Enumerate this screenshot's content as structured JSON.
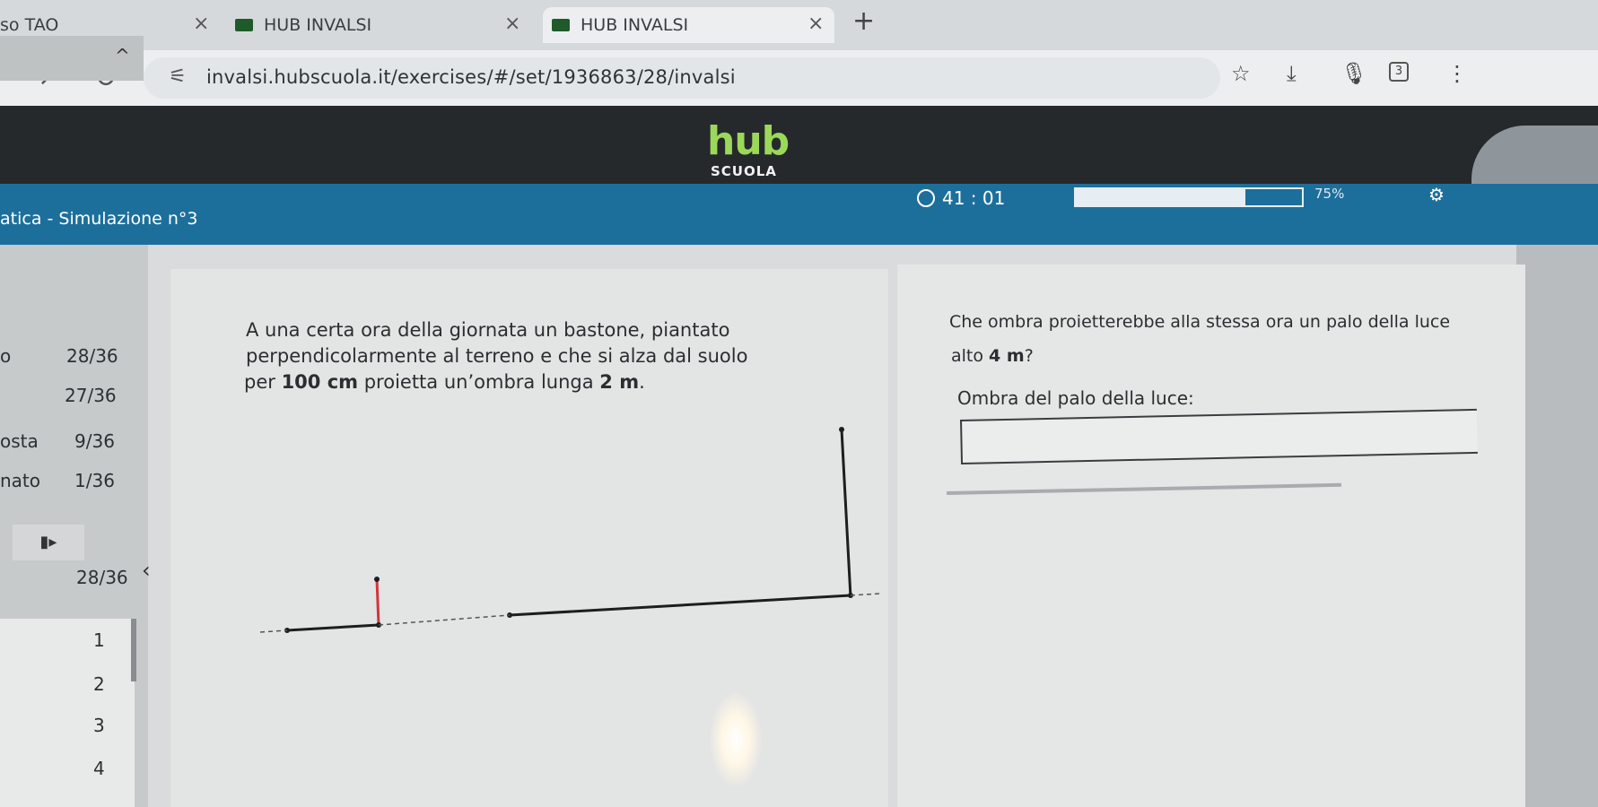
{
  "browser": {
    "tabs": [
      {
        "title": "so TAO",
        "close": "×"
      },
      {
        "title": "HUB INVALSI",
        "close": "×"
      },
      {
        "title": "HUB INVALSI",
        "close": "×"
      }
    ],
    "new_tab": "+",
    "url": "invalsi.hubscuola.it/exercises/#/set/1936863/28/invalsi",
    "extension_badge": "3"
  },
  "header": {
    "logo": "hub",
    "logo_sub": "SCUOLA"
  },
  "titlebar": {
    "title": "atica - Simulazione n°3",
    "timer": "41 : 01",
    "progress_percent": 75,
    "progress_label": "75%"
  },
  "sidebar": {
    "stats": [
      {
        "label": "o",
        "value": "28/36"
      },
      {
        "label": "",
        "value": "27/36"
      },
      {
        "label": "osta",
        "value": "9/36"
      },
      {
        "label": "nato",
        "value": "1/36"
      }
    ],
    "flag_icon": "▮▸",
    "counter": "28/36",
    "questions": [
      "1",
      "2",
      "3",
      "4"
    ]
  },
  "question": {
    "left_lines": [
      "A una certa ora della giornata un bastone, piantato",
      "perpendicolarmente al terreno e che si alza dal suolo"
    ],
    "left_line3_pre": "per ",
    "left_line3_b1": "100 cm",
    "left_line3_mid": " proietta un’ombra lunga ",
    "left_line3_b2": "2 m",
    "left_line3_end": ".",
    "right_line1": "Che ombra proietterebbe alla stessa ora un palo della luce",
    "right_line2_pre": "alto ",
    "right_line2_b": "4 m",
    "right_line2_end": "?",
    "answer_label": "Ombra del palo della luce:",
    "answer_value": ""
  },
  "colors": {
    "title_bar": "#1d6f9b",
    "header_bar": "#26292c",
    "logo_green": "#9bd85a",
    "stick_red": "#d4353d"
  }
}
